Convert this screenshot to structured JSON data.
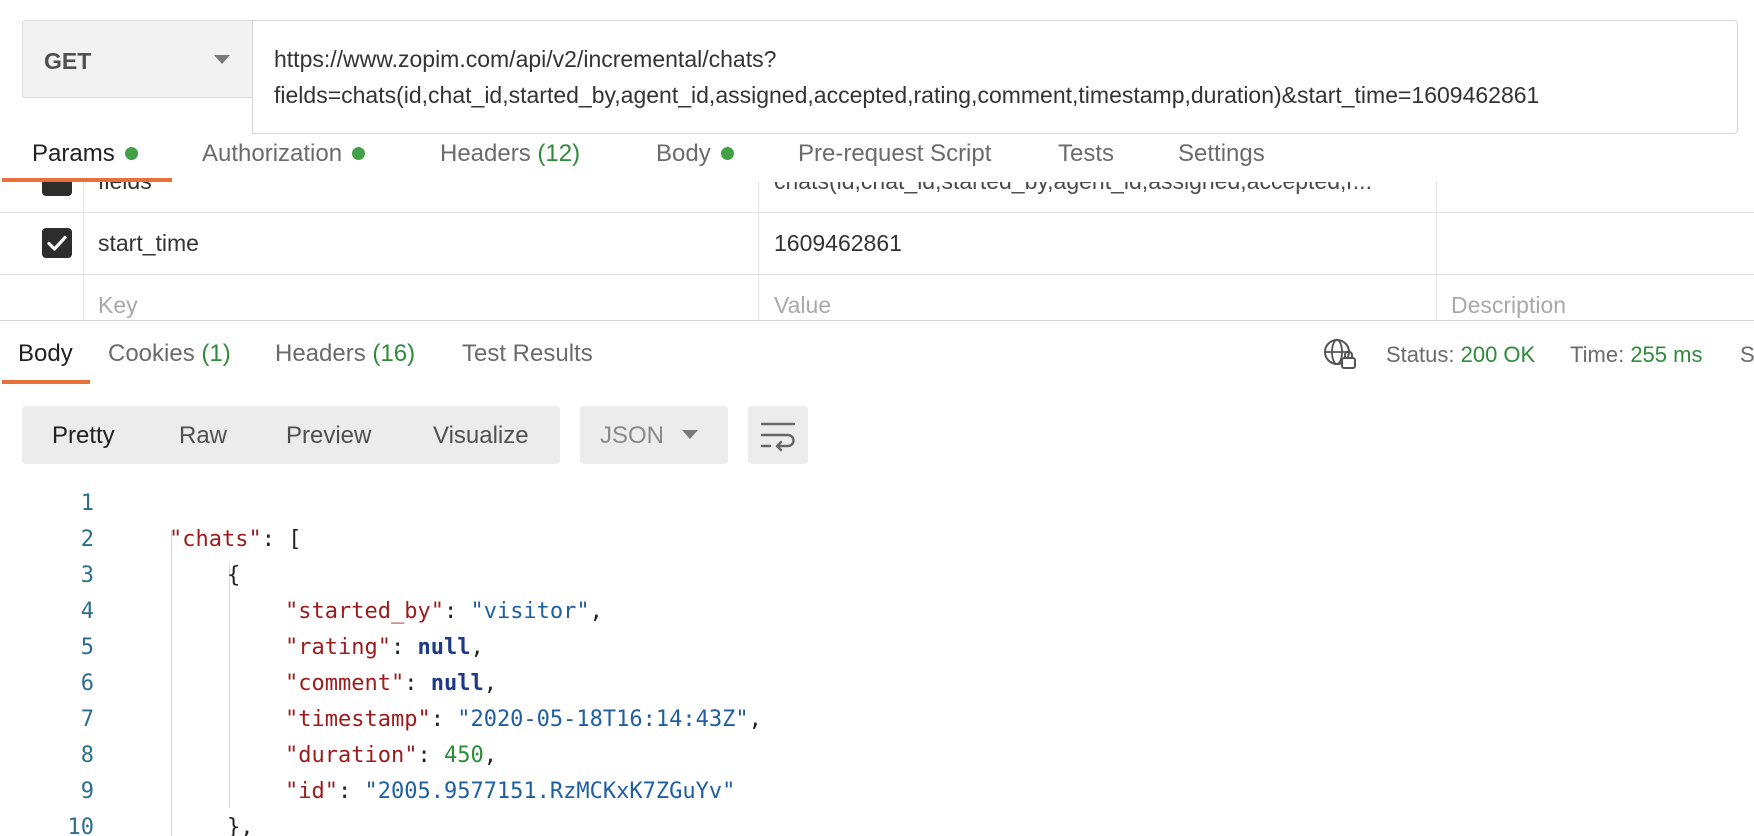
{
  "request": {
    "method": "GET",
    "url_line1": "https://www.zopim.com/api/v2/incremental/chats?",
    "url_line2": "fields=chats(id,chat_id,started_by,agent_id,assigned,accepted,rating,comment,timestamp,duration)&start_time=1609462861"
  },
  "request_tabs": [
    {
      "label": "Params",
      "dot": true
    },
    {
      "label": "Authorization",
      "dot": true
    },
    {
      "label": "Headers",
      "count": "(12)"
    },
    {
      "label": "Body",
      "dot": true
    },
    {
      "label": "Pre-request Script"
    },
    {
      "label": "Tests"
    },
    {
      "label": "Settings"
    }
  ],
  "params": {
    "rows": [
      {
        "key": "fields",
        "value": "chats(id,chat_id,started_by,agent_id,assigned,accepted,r..."
      },
      {
        "key": "start_time",
        "value": "1609462861"
      }
    ],
    "placeholders": {
      "key": "Key",
      "value": "Value",
      "description": "Description"
    }
  },
  "response_tabs": [
    {
      "label": "Body"
    },
    {
      "label": "Cookies",
      "count": "(1)"
    },
    {
      "label": "Headers",
      "count": "(16)"
    },
    {
      "label": "Test Results"
    }
  ],
  "response_meta": {
    "status_label": "Status:",
    "status_value": "200 OK",
    "time_label": "Time:",
    "time_value": "255 ms",
    "size_label_partial": "S"
  },
  "body_view": {
    "modes": [
      "Pretty",
      "Raw",
      "Preview",
      "Visualize"
    ],
    "format": "JSON"
  },
  "code": {
    "line_numbers": [
      "1",
      "2",
      "3",
      "4",
      "5",
      "6",
      "7",
      "8",
      "9",
      "10"
    ],
    "chats_key": "\"chats\"",
    "fields": [
      {
        "key": "\"started_by\"",
        "value": "\"visitor\""
      },
      {
        "key": "\"rating\"",
        "value": "null"
      },
      {
        "key": "\"comment\"",
        "value": "null"
      },
      {
        "key": "\"timestamp\"",
        "value": "\"2020-05-18T16:14:43Z\""
      },
      {
        "key": "\"duration\"",
        "value": "450"
      },
      {
        "key": "\"id\"",
        "value": "\"2005.9577151.RzMCKxK7ZGuYv\""
      }
    ]
  },
  "colors": {
    "accent": "#e8703a",
    "success": "#2e8b3a",
    "json_key": "#9b1c1c",
    "json_string": "#1f5fa0"
  }
}
